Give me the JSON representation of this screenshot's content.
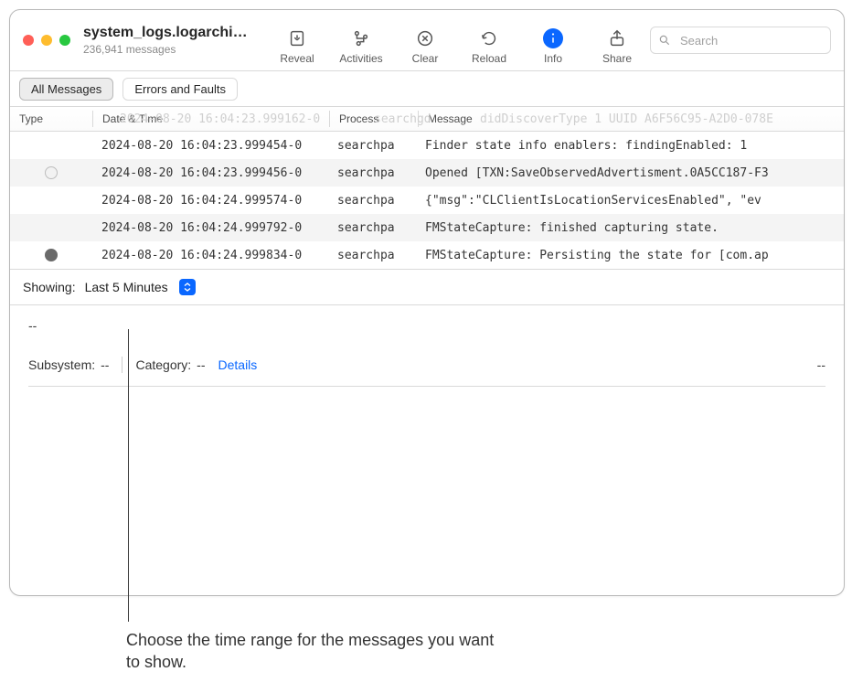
{
  "window": {
    "title": "system_logs.logarchi…",
    "subtitle": "236,941 messages"
  },
  "toolbar": {
    "reveal": "Reveal",
    "activities": "Activities",
    "clear": "Clear",
    "reload": "Reload",
    "info": "Info",
    "share": "Share",
    "search_placeholder": "Search"
  },
  "scope": {
    "all": "All Messages",
    "errors": "Errors and Faults"
  },
  "columns": {
    "type": "Type",
    "datetime": "Date & Time",
    "process": "Process",
    "message": "Message"
  },
  "faint_row": {
    "dt": "2024-08-20 16:04:23.999162-0",
    "proc": "searchgd",
    "msg": "didDiscoverType 1 UUID A6F56C95-A2D0-078E"
  },
  "rows": [
    {
      "type": "",
      "dt": "2024-08-20 16:04:23.999454-0",
      "proc": "searchpa",
      "msg": "Finder state info enablers:   findingEnabled: 1"
    },
    {
      "type": "open",
      "dt": "2024-08-20 16:04:23.999456-0",
      "proc": "searchpa",
      "msg": "Opened [TXN:SaveObservedAdvertisment.0A5CC187-F3"
    },
    {
      "type": "",
      "dt": "2024-08-20 16:04:24.999574-0",
      "proc": "searchpa",
      "msg": "{\"msg\":\"CLClientIsLocationServicesEnabled\", \"ev"
    },
    {
      "type": "",
      "dt": "2024-08-20 16:04:24.999792-0",
      "proc": "searchpa",
      "msg": "FMStateCapture: finished capturing state."
    },
    {
      "type": "fill",
      "dt": "2024-08-20 16:04:24.999834-0",
      "proc": "searchpa",
      "msg": "FMStateCapture: Persisting the state for [com.ap"
    }
  ],
  "showing_label": "Showing:",
  "showing_value": "Last 5 Minutes",
  "detail": {
    "dash": "--",
    "subsystem_label": "Subsystem:",
    "subsystem_value": "--",
    "category_label": "Category:",
    "category_value": "--",
    "details_link": "Details",
    "right_dash": "--"
  },
  "callout": "Choose the time range for the messages you want to show."
}
